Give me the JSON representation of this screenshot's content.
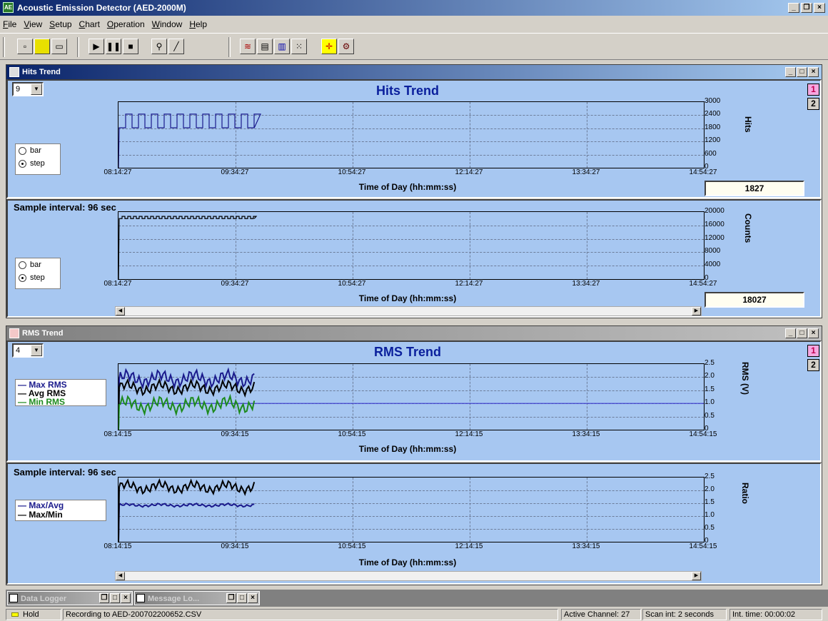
{
  "app": {
    "title": "Acoustic Emission Detector (AED-2000M)"
  },
  "menu": [
    "File",
    "View",
    "Setup",
    "Chart",
    "Operation",
    "Window",
    "Help"
  ],
  "toolbar_icons": [
    "new-icon",
    "open-icon",
    "save-icon",
    "play-icon",
    "pause-icon",
    "stop-icon",
    "probe-icon",
    "pen-icon",
    "chart-line-icon",
    "chart-area-icon",
    "chart-bar-icon",
    "chart-scatter-icon",
    "crosshair-icon",
    "settings-icon"
  ],
  "hits_window": {
    "title": "Hits Trend",
    "channel": "9",
    "chart_title": "Hits Trend",
    "page_buttons": [
      "1",
      "2"
    ],
    "top": {
      "radio": [
        "bar",
        "step"
      ],
      "selected": "step",
      "value": "1827"
    },
    "bottom": {
      "sample_interval": "Sample interval: 96 sec",
      "radio": [
        "bar",
        "step"
      ],
      "selected": "step",
      "value": "18027"
    },
    "xlabel": "Time of Day (hh:mm:ss)"
  },
  "rms_window": {
    "title": "RMS Trend",
    "channel": "4",
    "chart_title": "RMS Trend",
    "page_buttons": [
      "1",
      "2"
    ],
    "legend_top": [
      {
        "label": "Max RMS",
        "color": "#1a1a8c"
      },
      {
        "label": "Avg RMS",
        "color": "#000000"
      },
      {
        "label": "Min RMS",
        "color": "#1d8a1d"
      }
    ],
    "sample_interval": "Sample interval: 96 sec",
    "legend_bottom": [
      {
        "label": "Max/Avg",
        "color": "#1a1a8c"
      },
      {
        "label": "Max/Min",
        "color": "#000000"
      }
    ],
    "xlabel": "Time of Day (hh:mm:ss)"
  },
  "chart_data": [
    {
      "type": "line",
      "title": "Hits Trend",
      "xlabel": "Time of Day (hh:mm:ss)",
      "ylabel": "Hits",
      "x_ticks": [
        "08:14:27",
        "09:34:27",
        "10:54:27",
        "12:14:27",
        "13:34:27",
        "14:54:27"
      ],
      "y_ticks": [
        "3000",
        "2400",
        "1800",
        "1200",
        "600",
        "0"
      ],
      "ylim": [
        0,
        3000
      ],
      "grid": true,
      "series": [
        {
          "style": "step",
          "color": "#1a1a8c",
          "low": 1827,
          "high": 2450,
          "x_end": "09:43:00"
        }
      ]
    },
    {
      "type": "line",
      "xlabel": "Time of Day (hh:mm:ss)",
      "ylabel": "Counts",
      "x_ticks": [
        "08:14:27",
        "09:34:27",
        "10:54:27",
        "12:14:27",
        "13:34:27",
        "14:54:27"
      ],
      "y_ticks": [
        "20000",
        "16000",
        "12000",
        "8000",
        "4000",
        "0"
      ],
      "ylim": [
        0,
        20000
      ],
      "grid": true,
      "series": [
        {
          "style": "step",
          "color": "#000000",
          "low": 18027,
          "high": 18700,
          "x_end": "09:43:00"
        }
      ]
    },
    {
      "type": "line",
      "title": "RMS Trend",
      "xlabel": "Time of Day (hh:mm:ss)",
      "ylabel": "RMS (V)",
      "x_ticks": [
        "08:14:15",
        "09:34:15",
        "10:54:15",
        "12:14:15",
        "13:34:15",
        "14:54:15"
      ],
      "y_ticks": [
        "2.5",
        "2.0",
        "1.5",
        "1.0",
        "0.5",
        "0"
      ],
      "ylim": [
        0,
        2.5
      ],
      "grid": true,
      "series": [
        {
          "name": "Max RMS",
          "color": "#1a1a8c",
          "low": 1.6,
          "high": 2.3
        },
        {
          "name": "Avg RMS",
          "color": "#000000",
          "low": 1.3,
          "high": 1.9
        },
        {
          "name": "Min RMS",
          "color": "#1d8a1d",
          "low": 0.6,
          "high": 1.3
        }
      ],
      "threshold": 1.0
    },
    {
      "type": "line",
      "xlabel": "Time of Day (hh:mm:ss)",
      "ylabel": "Ratio",
      "x_ticks": [
        "08:14:15",
        "09:34:15",
        "10:54:15",
        "12:14:15",
        "13:34:15",
        "14:54:15"
      ],
      "y_ticks": [
        "2.5",
        "2.0",
        "1.5",
        "1.0",
        "0.5",
        "0"
      ],
      "ylim": [
        0,
        2.5
      ],
      "grid": true,
      "series": [
        {
          "name": "Max/Avg",
          "color": "#1a1a8c",
          "low": 1.35,
          "high": 1.5
        },
        {
          "name": "Max/Min",
          "color": "#000000",
          "low": 1.85,
          "high": 2.4
        }
      ]
    }
  ],
  "taskbar": [
    {
      "label": "Data Logger"
    },
    {
      "label": "Message Lo..."
    }
  ],
  "status": {
    "indicator": "Hold",
    "recording": "Recording to AED-200702200652.CSV",
    "channel": "Active Channel: 27",
    "scan": "Scan int: 2 seconds",
    "int_time": "Int. time: 00:00:02"
  }
}
